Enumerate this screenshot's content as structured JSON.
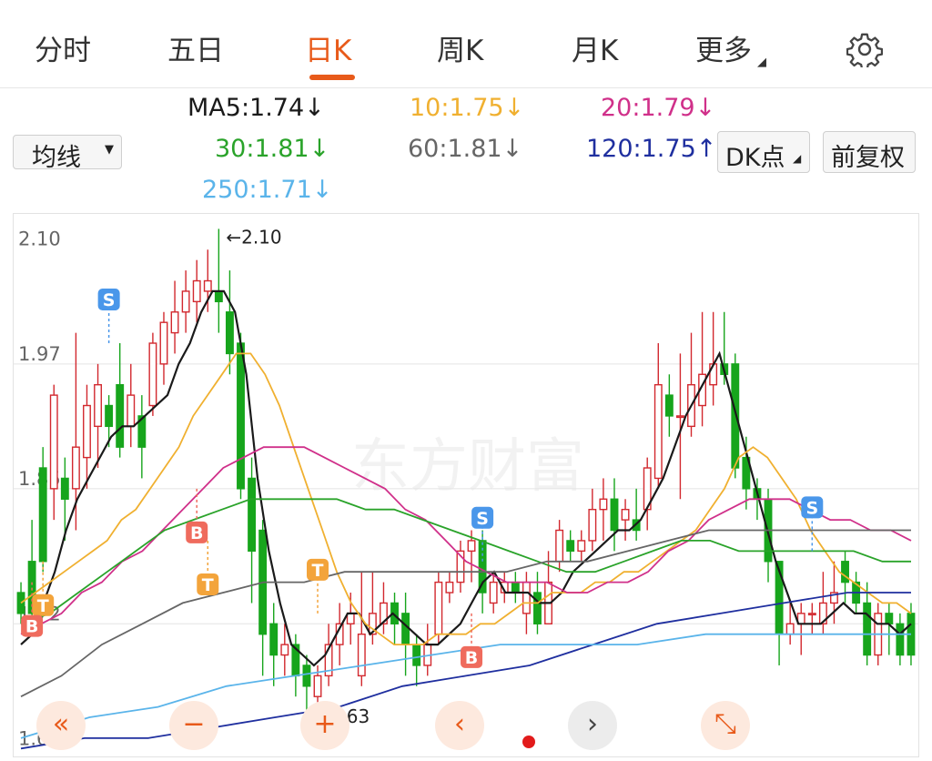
{
  "tabs": [
    "分时",
    "五日",
    "日K",
    "周K",
    "月K",
    "更多"
  ],
  "active_tab": "日K",
  "ma_selector": "均线",
  "ma_values": [
    {
      "label": "MA5:1.74↓",
      "color": "#1a1a1a"
    },
    {
      "label": "10:1.75↓",
      "color": "#f0b030"
    },
    {
      "label": "20:1.79↓",
      "color": "#d0308a"
    },
    {
      "label": "30:1.81↓",
      "color": "#2aa32a"
    },
    {
      "label": "60:1.81↓",
      "color": "#666666"
    },
    {
      "label": "120:1.75↑",
      "color": "#1f2f9f"
    },
    {
      "label": "250:1.71↓",
      "color": "#5ab4ea"
    }
  ],
  "buttons": {
    "dk": "DK点",
    "adjust": "前复权"
  },
  "watermark": "东方财富",
  "chart_data": {
    "type": "candlestick",
    "y_ticks": [
      2.1,
      1.97,
      1.85,
      1.72,
      1.6
    ],
    "y_tick_labels": [
      "2.10",
      "1.97",
      "1.85",
      "1.72",
      "1.60"
    ],
    "ylim": [
      1.595,
      2.11
    ],
    "grid": true,
    "max_label": "←2.10",
    "min_label": "←1.63",
    "candles": [
      [
        1.75,
        1.73,
        1.76,
        1.72
      ],
      [
        1.78,
        1.73,
        1.82,
        1.72
      ],
      [
        1.87,
        1.78,
        1.89,
        1.77
      ],
      [
        1.85,
        1.94,
        1.95,
        1.82
      ],
      [
        1.86,
        1.84,
        1.88,
        1.8
      ],
      [
        1.85,
        1.89,
        2.0,
        1.81
      ],
      [
        1.88,
        1.93,
        1.95,
        1.85
      ],
      [
        1.91,
        1.95,
        1.97,
        1.87
      ],
      [
        1.93,
        1.91,
        1.94,
        1.89
      ],
      [
        1.95,
        1.89,
        1.99,
        1.88
      ],
      [
        1.91,
        1.94,
        1.97,
        1.89
      ],
      [
        1.92,
        1.89,
        1.94,
        1.86
      ],
      [
        1.93,
        1.99,
        2.0,
        1.92
      ],
      [
        1.97,
        2.01,
        2.02,
        1.95
      ],
      [
        2.0,
        2.02,
        2.05,
        1.98
      ],
      [
        2.02,
        2.04,
        2.06,
        2.0
      ],
      [
        2.03,
        2.05,
        2.07,
        2.01
      ],
      [
        2.04,
        2.05,
        2.08,
        2.02
      ],
      [
        2.04,
        2.03,
        2.1,
        2.0
      ],
      [
        2.02,
        1.98,
        2.06,
        1.96
      ],
      [
        1.99,
        1.85,
        2.0,
        1.84
      ],
      [
        1.86,
        1.79,
        1.88,
        1.74
      ],
      [
        1.81,
        1.71,
        1.82,
        1.67
      ],
      [
        1.72,
        1.69,
        1.74,
        1.66
      ],
      [
        1.69,
        1.7,
        1.72,
        1.67
      ],
      [
        1.7,
        1.67,
        1.71,
        1.65
      ],
      [
        1.68,
        1.66,
        1.69,
        1.63
      ],
      [
        1.65,
        1.67,
        1.68,
        1.64
      ],
      [
        1.67,
        1.7,
        1.72,
        1.66
      ],
      [
        1.7,
        1.72,
        1.74,
        1.68
      ],
      [
        1.72,
        1.73,
        1.75,
        1.7
      ],
      [
        1.67,
        1.71,
        1.77,
        1.66
      ],
      [
        1.71,
        1.73,
        1.77,
        1.7
      ],
      [
        1.72,
        1.74,
        1.76,
        1.71
      ],
      [
        1.74,
        1.72,
        1.75,
        1.7
      ],
      [
        1.73,
        1.7,
        1.75,
        1.67
      ],
      [
        1.7,
        1.68,
        1.71,
        1.66
      ],
      [
        1.68,
        1.7,
        1.72,
        1.67
      ],
      [
        1.71,
        1.76,
        1.77,
        1.7
      ],
      [
        1.75,
        1.76,
        1.77,
        1.74
      ],
      [
        1.76,
        1.79,
        1.8,
        1.75
      ],
      [
        1.79,
        1.8,
        1.81,
        1.76
      ],
      [
        1.8,
        1.75,
        1.81,
        1.73
      ],
      [
        1.74,
        1.76,
        1.77,
        1.73
      ],
      [
        1.75,
        1.76,
        1.77,
        1.74
      ],
      [
        1.76,
        1.75,
        1.77,
        1.74
      ],
      [
        1.73,
        1.76,
        1.77,
        1.71
      ],
      [
        1.75,
        1.72,
        1.77,
        1.71
      ],
      [
        1.72,
        1.76,
        1.79,
        1.72
      ],
      [
        1.78,
        1.81,
        1.82,
        1.77
      ],
      [
        1.8,
        1.79,
        1.81,
        1.78
      ],
      [
        1.79,
        1.8,
        1.81,
        1.78
      ],
      [
        1.8,
        1.83,
        1.85,
        1.79
      ],
      [
        1.83,
        1.84,
        1.86,
        1.8
      ],
      [
        1.84,
        1.81,
        1.86,
        1.79
      ],
      [
        1.82,
        1.83,
        1.84,
        1.8
      ],
      [
        1.82,
        1.81,
        1.85,
        1.8
      ],
      [
        1.83,
        1.87,
        1.88,
        1.81
      ],
      [
        1.86,
        1.95,
        1.99,
        1.85
      ],
      [
        1.94,
        1.92,
        1.96,
        1.9
      ],
      [
        1.92,
        1.92,
        1.98,
        1.84
      ],
      [
        1.91,
        1.95,
        2.0,
        1.9
      ],
      [
        1.93,
        1.96,
        2.02,
        1.91
      ],
      [
        1.95,
        1.97,
        2.02,
        1.93
      ],
      [
        1.97,
        1.96,
        2.02,
        1.95
      ],
      [
        1.97,
        1.87,
        1.98,
        1.86
      ],
      [
        1.88,
        1.85,
        1.9,
        1.83
      ],
      [
        1.85,
        1.84,
        1.86,
        1.82
      ],
      [
        1.84,
        1.78,
        1.85,
        1.76
      ],
      [
        1.78,
        1.71,
        1.78,
        1.68
      ],
      [
        1.71,
        1.72,
        1.74,
        1.7
      ],
      [
        1.72,
        1.73,
        1.74,
        1.69
      ],
      [
        1.73,
        1.73,
        1.74,
        1.71
      ],
      [
        1.72,
        1.74,
        1.77,
        1.71
      ],
      [
        1.74,
        1.75,
        1.78,
        1.72
      ],
      [
        1.78,
        1.76,
        1.79,
        1.74
      ],
      [
        1.76,
        1.74,
        1.77,
        1.73
      ],
      [
        1.74,
        1.69,
        1.76,
        1.68
      ],
      [
        1.69,
        1.73,
        1.74,
        1.68
      ],
      [
        1.73,
        1.72,
        1.74,
        1.69
      ],
      [
        1.72,
        1.69,
        1.73,
        1.68
      ],
      [
        1.73,
        1.69,
        1.74,
        1.68
      ]
    ],
    "ma_series": {
      "MA5": [
        1.7,
        1.71,
        1.74,
        1.77,
        1.81,
        1.84,
        1.86,
        1.88,
        1.9,
        1.91,
        1.91,
        1.92,
        1.93,
        1.94,
        1.97,
        1.99,
        2.02,
        2.04,
        2.04,
        2.02,
        1.96,
        1.86,
        1.79,
        1.74,
        1.7,
        1.69,
        1.68,
        1.69,
        1.71,
        1.73,
        1.73,
        1.71,
        1.72,
        1.73,
        1.72,
        1.71,
        1.7,
        1.7,
        1.71,
        1.72,
        1.74,
        1.76,
        1.77,
        1.75,
        1.75,
        1.75,
        1.74,
        1.74,
        1.75,
        1.77,
        1.78,
        1.79,
        1.8,
        1.81,
        1.81,
        1.82,
        1.84,
        1.86,
        1.89,
        1.92,
        1.94,
        1.96,
        1.98,
        1.94,
        1.9,
        1.86,
        1.82,
        1.78,
        1.75,
        1.72,
        1.72,
        1.72,
        1.73,
        1.74,
        1.73,
        1.73,
        1.72,
        1.72,
        1.71,
        1.72
      ],
      "MA10": [
        1.74,
        1.75,
        1.76,
        1.77,
        1.78,
        1.79,
        1.8,
        1.82,
        1.83,
        1.85,
        1.87,
        1.89,
        1.92,
        1.94,
        1.96,
        1.98,
        1.98,
        1.96,
        1.93,
        1.89,
        1.85,
        1.81,
        1.77,
        1.74,
        1.72,
        1.71,
        1.7,
        1.7,
        1.7,
        1.71,
        1.71,
        1.71,
        1.72,
        1.72,
        1.73,
        1.74,
        1.74,
        1.75,
        1.75,
        1.75,
        1.76,
        1.76,
        1.77,
        1.77,
        1.78,
        1.79,
        1.8,
        1.81,
        1.83,
        1.85,
        1.88,
        1.89,
        1.88,
        1.86,
        1.84,
        1.81,
        1.79,
        1.77,
        1.76,
        1.75,
        1.74,
        1.74,
        1.73
      ],
      "MA20": [
        1.71,
        1.72,
        1.73,
        1.75,
        1.76,
        1.78,
        1.79,
        1.81,
        1.83,
        1.85,
        1.87,
        1.88,
        1.89,
        1.89,
        1.89,
        1.88,
        1.87,
        1.86,
        1.85,
        1.83,
        1.82,
        1.8,
        1.78,
        1.77,
        1.76,
        1.76,
        1.76,
        1.75,
        1.75,
        1.76,
        1.76,
        1.77,
        1.79,
        1.8,
        1.82,
        1.83,
        1.84,
        1.84,
        1.84,
        1.83,
        1.82,
        1.82,
        1.81,
        1.81,
        1.8
      ],
      "MA30": [
        1.72,
        1.73,
        1.75,
        1.77,
        1.79,
        1.81,
        1.82,
        1.83,
        1.84,
        1.84,
        1.84,
        1.84,
        1.83,
        1.83,
        1.82,
        1.81,
        1.8,
        1.79,
        1.78,
        1.77,
        1.77,
        1.78,
        1.79,
        1.8,
        1.8,
        1.79,
        1.79,
        1.79,
        1.79,
        1.79,
        1.78,
        1.78
      ],
      "MA60": [
        1.65,
        1.67,
        1.7,
        1.72,
        1.74,
        1.75,
        1.76,
        1.76,
        1.77,
        1.77,
        1.77,
        1.77,
        1.77,
        1.78,
        1.78,
        1.79,
        1.8,
        1.81,
        1.81,
        1.81,
        1.81,
        1.81,
        1.81
      ],
      "MA120": [
        1.6,
        1.61,
        1.61,
        1.62,
        1.63,
        1.64,
        1.66,
        1.67,
        1.68,
        1.7,
        1.72,
        1.73,
        1.74,
        1.75,
        1.75
      ],
      "MA250": [
        1.61,
        1.63,
        1.64,
        1.66,
        1.67,
        1.68,
        1.69,
        1.7,
        1.7,
        1.7,
        1.71,
        1.71,
        1.71,
        1.71
      ]
    },
    "markers": [
      {
        "label": "S",
        "candle": 8,
        "price": 1.99,
        "side": "above",
        "color": "#4a97ea"
      },
      {
        "label": "T",
        "candle": 2,
        "price": 1.78,
        "side": "below",
        "color": "#f3a43b"
      },
      {
        "label": "B",
        "candle": 1,
        "price": 1.76,
        "side": "below",
        "color": "#ef6b5d"
      },
      {
        "label": "B",
        "candle": 16,
        "price": 1.85,
        "side": "below",
        "color": "#ef6b5d"
      },
      {
        "label": "T",
        "candle": 17,
        "price": 1.8,
        "side": "below",
        "color": "#f3a43b"
      },
      {
        "label": "T",
        "candle": 27,
        "price": 1.73,
        "side": "above",
        "color": "#f3a43b"
      },
      {
        "label": "S",
        "candle": 42,
        "price": 1.78,
        "side": "above",
        "color": "#4a97ea"
      },
      {
        "label": "B",
        "candle": 41,
        "price": 1.73,
        "side": "below",
        "color": "#ef6b5d"
      },
      {
        "label": "S",
        "candle": 72,
        "price": 1.79,
        "side": "above",
        "color": "#4a97ea"
      }
    ]
  }
}
